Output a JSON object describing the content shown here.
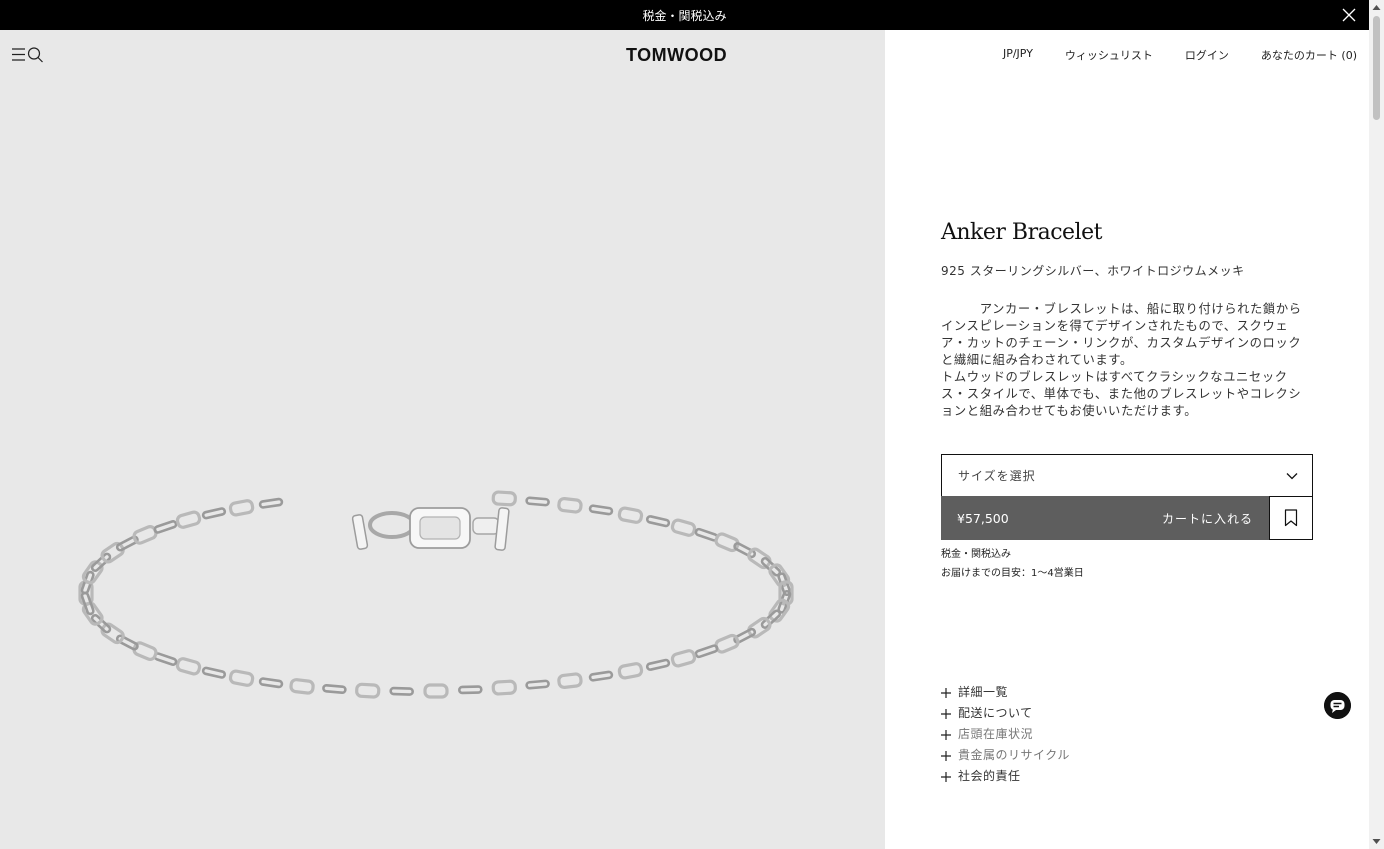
{
  "topbar": {
    "text": "税金・関税込み"
  },
  "header": {
    "logo": "TOMWOOD",
    "nav": {
      "region": "JP/JPY",
      "wishlist": "ウィッシュリスト",
      "login": "ログイン",
      "cart": "あなたのカート (0)"
    }
  },
  "product": {
    "title": "Anker Bracelet",
    "material": "925 スターリングシルバー、ホワイトロジウムメッキ",
    "description": "　　　アンカー・ブレスレットは、船に取り付けられた鎖からインスピレーションを得てデザインされたもので、スクウェア・カットのチェーン・リンクが、カスタムデザインのロックと繊細に組み合わされています。\n トムウッドのブレスレットはすべてクラシックなユニセックス・スタイルで、単体でも、また他のブレスレットやコレクションと組み合わせてもお使いいただけます。",
    "size_placeholder": "サイズを選択",
    "price": "¥57,500",
    "add_to_cart": "カートに入れる",
    "tax_note": "税金・関税込み",
    "delivery_note": "お届けまでの目安：1〜4営業日"
  },
  "accordion": [
    {
      "label": "詳細一覧"
    },
    {
      "label": "配送について"
    },
    {
      "label": "店頭在庫状況"
    },
    {
      "label": "貴金属のリサイクル"
    },
    {
      "label": "社会的責任"
    }
  ],
  "colors": {
    "topbar_bg": "#000000",
    "image_bg": "#e8e8e8",
    "add_button_bg": "#5e5e5e"
  },
  "icons": {
    "close": "close-icon",
    "menu": "menu-icon",
    "search": "search-icon",
    "chevron": "chevron-down-icon",
    "bookmark": "bookmark-icon",
    "plus": "plus-icon",
    "chat": "chat-icon"
  }
}
